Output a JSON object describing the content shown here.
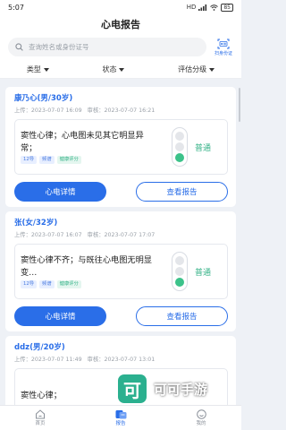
{
  "status_bar": {
    "time": "5:07",
    "battery": "85",
    "network": "HD"
  },
  "header": {
    "title": "心电报告"
  },
  "search": {
    "placeholder": "查询姓名或身份证号",
    "scan_label": "扫身份证"
  },
  "filters": [
    {
      "label": "类型"
    },
    {
      "label": "状态"
    },
    {
      "label": "评估分级"
    }
  ],
  "cards": [
    {
      "name": "康乃心(男/30岁)",
      "upload": "上传：2023-07-07 16:09",
      "review": "审核：2023-07-07 16:21",
      "result": "窦性心律；心电图未见其它明显异常；",
      "tags": [
        "12导",
        "频谱",
        "健康评分"
      ],
      "grade": "普通",
      "detail_btn": "心电详情",
      "report_btn": "查看报告"
    },
    {
      "name": "张(女/32岁)",
      "upload": "上传：2023-07-07 16:07",
      "review": "审核：2023-07-07 17:07",
      "result": "窦性心律不齐；与既往心电图无明显变…",
      "tags": [
        "12导",
        "频谱",
        "健康评分"
      ],
      "grade": "普通",
      "detail_btn": "心电详情",
      "report_btn": "查看报告"
    },
    {
      "name": "ddz(男/20岁)",
      "upload": "上传：2023-07-07 11:49",
      "review": "审核：2023-07-07 13:01",
      "result": "窦性心律；",
      "tags": [],
      "grade": "",
      "detail_btn": "",
      "report_btn": ""
    }
  ],
  "tabbar": [
    {
      "label": "首页",
      "icon": "home-icon"
    },
    {
      "label": "报告",
      "icon": "report-icon"
    },
    {
      "label": "我的",
      "icon": "profile-icon"
    }
  ],
  "watermark": {
    "glyph": "可",
    "text": "可可手游"
  },
  "colors": {
    "primary": "#2a6ee8",
    "success": "#34b287",
    "background": "#eef1f6"
  }
}
